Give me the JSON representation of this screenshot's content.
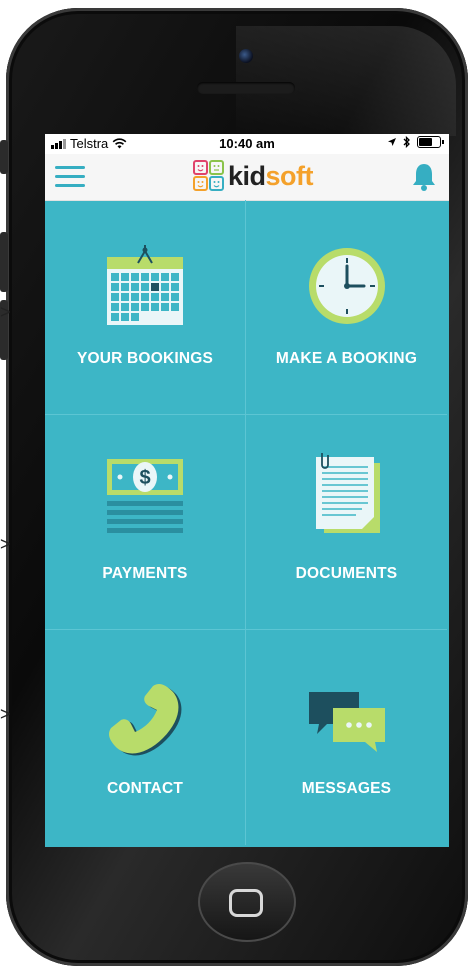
{
  "status_bar": {
    "carrier": "Telstra",
    "time": "10:40 am"
  },
  "nav": {
    "logo_prefix": "kid",
    "logo_suffix": "soft"
  },
  "tiles": [
    {
      "label": "YOUR BOOKINGS",
      "icon": "calendar-icon"
    },
    {
      "label": "MAKE A BOOKING",
      "icon": "clock-icon"
    },
    {
      "label": "PAYMENTS",
      "icon": "money-icon"
    },
    {
      "label": "DOCUMENTS",
      "icon": "documents-icon"
    },
    {
      "label": "CONTACT",
      "icon": "phone-icon"
    },
    {
      "label": "MESSAGES",
      "icon": "chat-bubbles-icon"
    }
  ],
  "colors": {
    "screen_bg": "#3db6c6",
    "accent": "#36aec2",
    "tile_label": "#ffffff",
    "icon_green": "#b8dc6a",
    "bell": "#36aec2"
  }
}
